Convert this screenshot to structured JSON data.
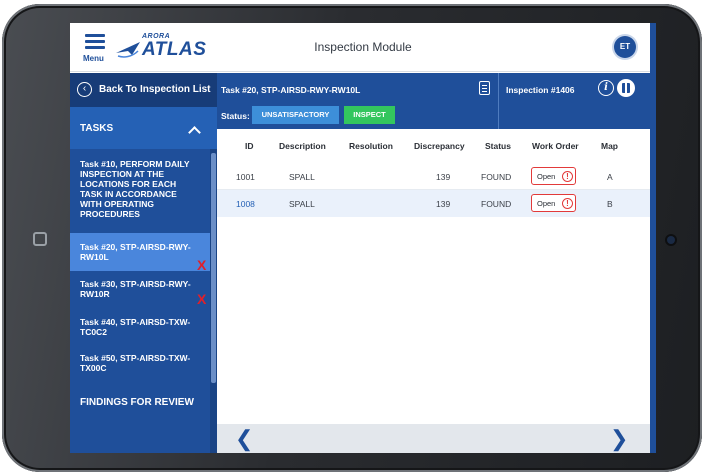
{
  "app": {
    "menu_label": "Menu",
    "logo_small": "ARORA",
    "logo_big": "ATLAS",
    "title": "Inspection Module",
    "user_initials": "ET"
  },
  "sidebar": {
    "back_label": "Back To Inspection List",
    "tasks_header": "TASKS",
    "tasks": [
      {
        "label": "Task #10, PERFORM DAILY INSPECTION AT THE LOCATIONS FOR EACH TASK IN ACCORDANCE WITH OPERATING PROCEDURES",
        "active": false,
        "flag": ""
      },
      {
        "label": "Task #20, STP-AIRSD-RWY-RW10L",
        "active": true,
        "flag": "X"
      },
      {
        "label": "Task #30, STP-AIRSD-RWY-RW10R",
        "active": false,
        "flag": "X"
      },
      {
        "label": "Task #40, STP-AIRSD-TXW-TC0C2",
        "active": false,
        "flag": ""
      },
      {
        "label": "Task #50, STP-AIRSD-TXW-TX00C",
        "active": false,
        "flag": ""
      }
    ],
    "findings_label": "FINDINGS FOR REVIEW"
  },
  "task_panel": {
    "title": "Task #20, STP-AIRSD-RWY-RW10L",
    "inspection_label": "Inspection #1406",
    "status_label": "Status:",
    "btn_unsatisfactory": "UNSATISFACTORY",
    "btn_inspect": "INSPECT",
    "colors": {
      "header": "#1f4f9a",
      "unsatisfactory": "#3d8fd9",
      "inspect": "#33c65e",
      "alert": "#e23a3a"
    }
  },
  "table": {
    "columns": [
      "ID",
      "Description",
      "Resolution",
      "Discrepancy",
      "Status",
      "Work Order",
      "Map"
    ],
    "rows": [
      {
        "id": "1001",
        "description": "SPALL",
        "resolution": "",
        "discrepancy": "139",
        "status": "FOUND",
        "work_order": "Open",
        "map": "A"
      },
      {
        "id": "1008",
        "description": "SPALL",
        "resolution": "",
        "discrepancy": "139",
        "status": "FOUND",
        "work_order": "Open",
        "map": "B"
      }
    ]
  },
  "footer": {
    "prev_icon": "chevron-left-icon",
    "next_icon": "chevron-right-icon"
  }
}
